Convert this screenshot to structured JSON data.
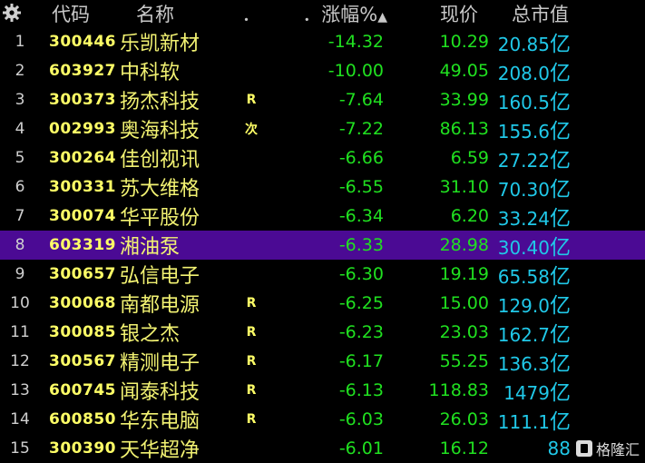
{
  "header": {
    "settings_icon": "gear-icon",
    "code": "代码",
    "name": "名称",
    "dot": "．",
    "pct": "．涨幅%",
    "sort_icon": "sort-up-arrow-icon",
    "price": "现价",
    "cap": "总市值"
  },
  "rows": [
    {
      "num": "1",
      "code": "300446",
      "name": "乐凯新材",
      "flag": "",
      "pct": "-14.32",
      "price": "10.29",
      "cap": "20.85",
      "unit": "亿"
    },
    {
      "num": "2",
      "code": "603927",
      "name": "中科软",
      "flag": "",
      "pct": "-10.00",
      "price": "49.05",
      "cap": "208.0",
      "unit": "亿"
    },
    {
      "num": "3",
      "code": "300373",
      "name": "扬杰科技",
      "flag": "R",
      "pct": "-7.64",
      "price": "33.99",
      "cap": "160.5",
      "unit": "亿"
    },
    {
      "num": "4",
      "code": "002993",
      "name": "奥海科技",
      "flag": "次",
      "pct": "-7.22",
      "price": "86.13",
      "cap": "155.6",
      "unit": "亿"
    },
    {
      "num": "5",
      "code": "300264",
      "name": "佳创视讯",
      "flag": "",
      "pct": "-6.66",
      "price": "6.59",
      "cap": "27.22",
      "unit": "亿"
    },
    {
      "num": "6",
      "code": "300331",
      "name": "苏大维格",
      "flag": "",
      "pct": "-6.55",
      "price": "31.10",
      "cap": "70.30",
      "unit": "亿"
    },
    {
      "num": "7",
      "code": "300074",
      "name": "华平股份",
      "flag": "",
      "pct": "-6.34",
      "price": "6.20",
      "cap": "33.24",
      "unit": "亿"
    },
    {
      "num": "8",
      "code": "603319",
      "name": "湘油泵",
      "flag": "",
      "pct": "-6.33",
      "price": "28.98",
      "cap": "30.40",
      "unit": "亿"
    },
    {
      "num": "9",
      "code": "300657",
      "name": "弘信电子",
      "flag": "",
      "pct": "-6.30",
      "price": "19.19",
      "cap": "65.58",
      "unit": "亿"
    },
    {
      "num": "10",
      "code": "300068",
      "name": "南都电源",
      "flag": "R",
      "pct": "-6.25",
      "price": "15.00",
      "cap": "129.0",
      "unit": "亿"
    },
    {
      "num": "11",
      "code": "300085",
      "name": "银之杰",
      "flag": "R",
      "pct": "-6.23",
      "price": "23.03",
      "cap": "162.7",
      "unit": "亿"
    },
    {
      "num": "12",
      "code": "300567",
      "name": "精测电子",
      "flag": "R",
      "pct": "-6.17",
      "price": "55.25",
      "cap": "136.3",
      "unit": "亿"
    },
    {
      "num": "13",
      "code": "600745",
      "name": "闻泰科技",
      "flag": "R",
      "pct": "-6.13",
      "price": "118.83",
      "cap": "1479",
      "unit": "亿"
    },
    {
      "num": "14",
      "code": "600850",
      "name": "华东电脑",
      "flag": "R",
      "pct": "-6.03",
      "price": "26.03",
      "cap": "111.1",
      "unit": "亿"
    },
    {
      "num": "15",
      "code": "300390",
      "name": "天华超净",
      "flag": "",
      "pct": "-6.01",
      "price": "16.12",
      "cap": "88",
      "unit": ""
    }
  ],
  "selected_row_index": 7,
  "watermark": {
    "text": "格隆汇",
    "icon": "gelonghui-logo-icon"
  },
  "colors": {
    "background": "#000000",
    "code": "#ffff66",
    "name": "#f2f272",
    "down": "#20e020",
    "market_cap": "#20c8e8",
    "selected_row": "#4b0a94"
  }
}
